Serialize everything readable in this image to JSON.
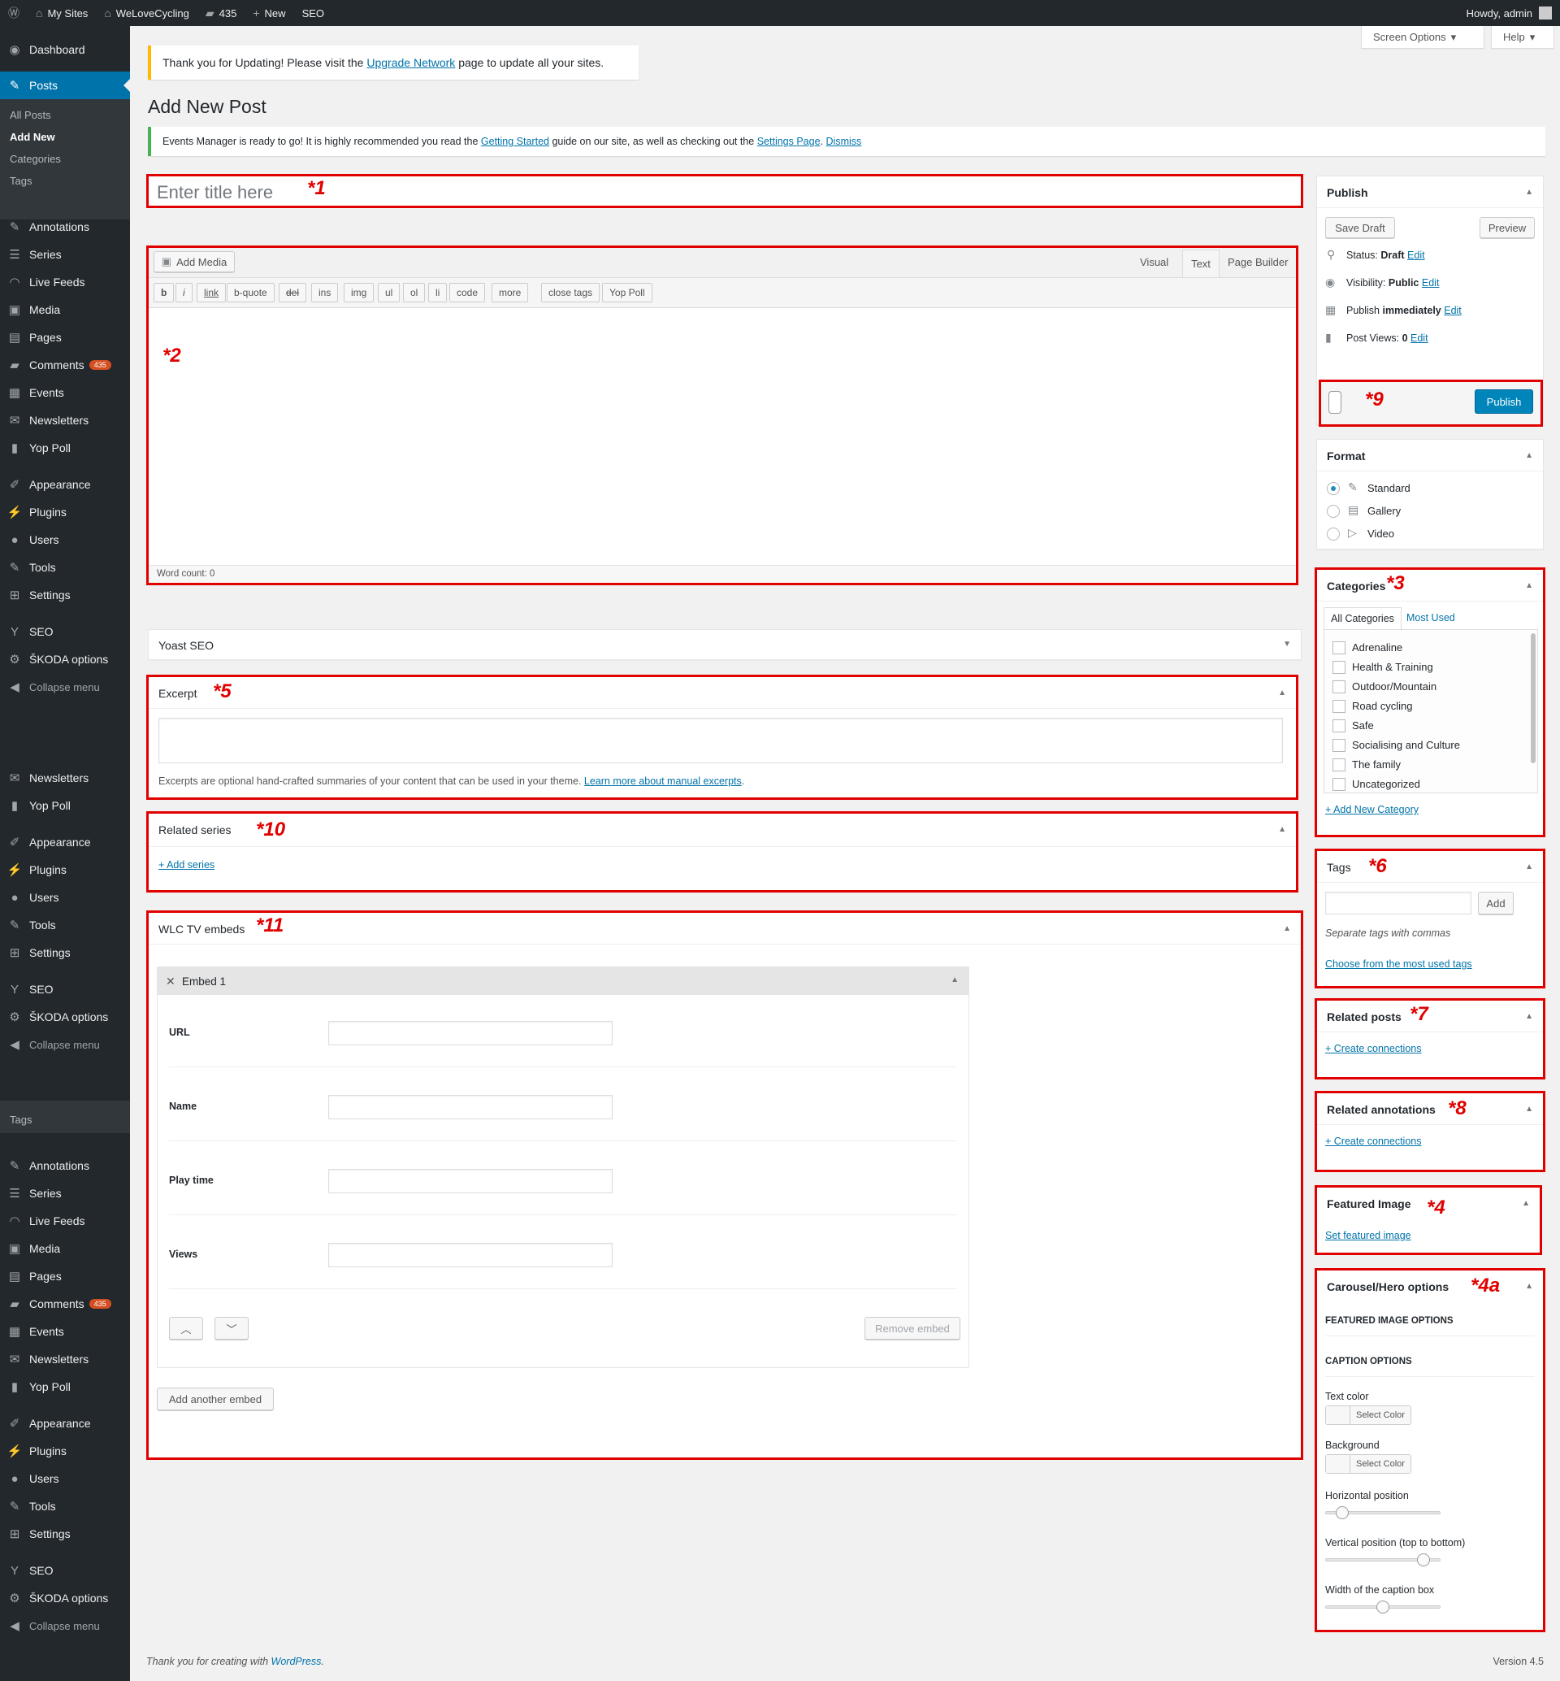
{
  "admin_bar": {
    "wp_logo": "wordpress-icon",
    "my_sites": "My Sites",
    "site_name": "WeLoveCycling",
    "comments_count": "435",
    "new": "New",
    "seo": "SEO",
    "howdy": "Howdy, admin"
  },
  "sidebar": {
    "dashboard": "Dashboard",
    "posts": "Posts",
    "submenu": [
      "All Posts",
      "Add New",
      "Categories",
      "Tags"
    ],
    "group_a": [
      "Annotations",
      "Series",
      "Live Feeds",
      "Media",
      "Pages",
      "Comments",
      "Events",
      "Newsletters",
      "Yop Poll"
    ],
    "comments_badge": "435",
    "group_b": [
      "Appearance",
      "Plugins",
      "Users",
      "Tools",
      "Settings"
    ],
    "group_c": [
      "SEO",
      "ŠKODA options"
    ],
    "collapse": "Collapse menu"
  },
  "screen_options": {
    "screen_options": "Screen Options",
    "help": "Help"
  },
  "notices": {
    "update_before": "Thank you for Updating! Please visit the ",
    "update_link": "Upgrade Network",
    "update_after": " page to update all your sites.",
    "events_before": "Events Manager is ready to go! It is highly recommended you read the ",
    "events_link1": "Getting Started",
    "events_mid": " guide on our site, as well as checking out the ",
    "events_link2": "Settings Page",
    "events_dot": ".",
    "events_dismiss": "Dismiss"
  },
  "page_title": "Add New Post",
  "title_placeholder": "Enter title here",
  "markers": {
    "m1": "*1",
    "m2": "*2",
    "m3": "*3",
    "m4": "*4",
    "m4a": "*4a",
    "m5": "*5",
    "m6": "*6",
    "m7": "*7",
    "m8": "*8",
    "m9": "*9",
    "m10": "*10",
    "m11": "*11"
  },
  "editor": {
    "add_media": "Add Media",
    "tabs": [
      "Visual",
      "Text",
      "Page Builder"
    ],
    "quicktags": [
      "b",
      "i",
      "link",
      "b-quote",
      "del",
      "ins",
      "img",
      "ul",
      "ol",
      "li",
      "code",
      "more",
      "close tags",
      "Yop Poll"
    ],
    "word_count": "Word count: 0"
  },
  "yoast": {
    "title": "Yoast SEO"
  },
  "excerpt": {
    "title": "Excerpt",
    "help_before": "Excerpts are optional hand-crafted summaries of your content that can be used in your theme. ",
    "help_link": "Learn more about manual excerpts",
    "help_after": "."
  },
  "related_series": {
    "title": "Related series",
    "link": "+ Add series"
  },
  "wlc_tv": {
    "title": "WLC TV embeds",
    "embed_title": "Embed 1",
    "fields": [
      "URL",
      "Name",
      "Play time",
      "Views"
    ],
    "remove": "Remove embed",
    "add_another": "Add another embed"
  },
  "publish": {
    "title": "Publish",
    "save_draft": "Save Draft",
    "preview": "Preview",
    "status_label": "Status: ",
    "status_value": "Draft",
    "visibility_label": "Visibility: ",
    "visibility_value": "Public",
    "publish_label": "Publish ",
    "publish_value": "immediately",
    "views_label": "Post Views: ",
    "views_value": "0",
    "edit": "Edit",
    "publish_button": "Publish"
  },
  "format": {
    "title": "Format",
    "options": [
      "Standard",
      "Gallery",
      "Video"
    ],
    "selected": "Standard"
  },
  "categories": {
    "title": "Categories",
    "tab_all": "All Categories",
    "tab_used": "Most Used",
    "items": [
      "Adrenaline",
      "Health & Training",
      "Outdoor/Mountain",
      "Road cycling",
      "Safe",
      "Socialising and Culture",
      "The family",
      "Uncategorized"
    ],
    "add_new": "+ Add New Category"
  },
  "tags": {
    "title": "Tags",
    "add": "Add",
    "help": "Separate tags with commas",
    "choose": "Choose from the most used tags"
  },
  "related_posts": {
    "title": "Related posts",
    "link": "+ Create connections"
  },
  "related_annotations": {
    "title": "Related annotations",
    "link": "+ Create connections"
  },
  "featured_image": {
    "title": "Featured Image",
    "link": "Set featured image"
  },
  "carousel": {
    "title": "Carousel/Hero options",
    "featured_section": "FEATURED IMAGE OPTIONS",
    "caption_section": "CAPTION OPTIONS",
    "text_color": "Text color",
    "background": "Background",
    "select_color": "Select Color",
    "horizontal": "Horizontal position",
    "vertical": "Vertical position (top to bottom)",
    "width": "Width of the caption box",
    "horizontal_value": 0.1,
    "vertical_value": 0.9,
    "width_value": 0.5
  },
  "footer": {
    "thanks": "Thank you for creating with ",
    "wp": "WordPress",
    "dot": ".",
    "version": "Version 4.5"
  },
  "colors": {
    "accent": "#0073aa",
    "sidebar": "#23282d",
    "annotation": "#e00000"
  }
}
